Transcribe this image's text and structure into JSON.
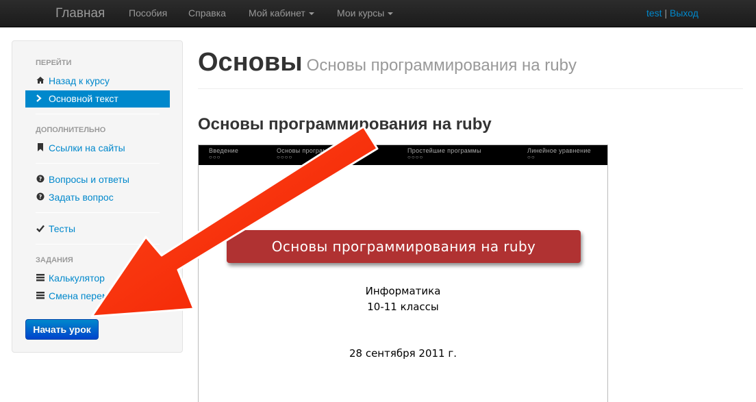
{
  "navbar": {
    "brand": "Главная",
    "items": [
      {
        "label": "Пособия"
      },
      {
        "label": "Справка"
      },
      {
        "label": "Мой кабинет"
      },
      {
        "label": "Мои курсы"
      }
    ],
    "user": "test",
    "separator": "|",
    "logout": "Выход"
  },
  "sidebar": {
    "header_go": "Перейти",
    "back_link": "Назад к курсу",
    "active_link": "Основной текст",
    "header_extra": "Дополнительно",
    "links_sites": "Ссылки на сайты",
    "qa": "Вопросы и ответы",
    "ask": "Задать вопрос",
    "tests": "Тесты",
    "header_tasks": "Задания",
    "calculator": "Калькулятор",
    "var_change": "Смена переме",
    "start_button": "Начать урок"
  },
  "main": {
    "title": "Основы",
    "subtitle": "Основы программирования на ruby",
    "section_title": "Основы программирования на ruby"
  },
  "slide": {
    "sections": [
      {
        "label": "Введение",
        "dots": "○○○"
      },
      {
        "label": "Основы программирования",
        "dots": "○○○○"
      },
      {
        "label": "Простейшие программы",
        "dots": "○○○○"
      },
      {
        "label": "Линейное уравнение",
        "dots": "○○"
      }
    ],
    "banner": "Основы программирования на ruby",
    "subject": "Информатика",
    "grades": "10-11 классы",
    "date": "28 сентября 2011 г."
  },
  "colors": {
    "accent": "#0088cc",
    "arrow": "#ff2a0a",
    "banner": "#b03232"
  },
  "icons": {
    "home": "home-icon",
    "chevron": "chevron-right-icon",
    "bookmark": "bookmark-icon",
    "question": "question-circle-icon",
    "check": "check-icon",
    "list": "list-icon"
  }
}
